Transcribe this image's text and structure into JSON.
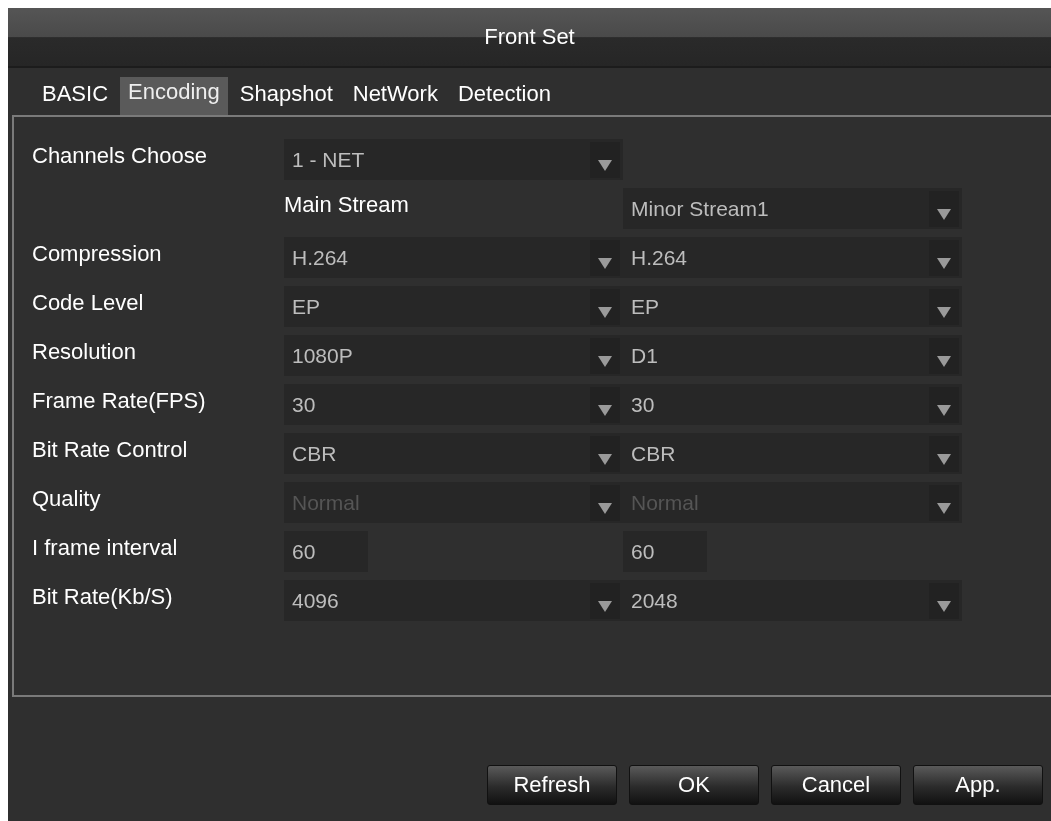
{
  "window": {
    "title": "Front Set"
  },
  "tabs": [
    {
      "label": "BASIC",
      "selected": false
    },
    {
      "label": "Encoding",
      "selected": true
    },
    {
      "label": "Shapshot",
      "selected": false
    },
    {
      "label": "NetWork",
      "selected": false
    },
    {
      "label": "Detection",
      "selected": false
    }
  ],
  "channel": {
    "label": "Channels Choose",
    "value": "1 - NET"
  },
  "streams": {
    "main": {
      "kind": "label",
      "value": "Main Stream"
    },
    "minor": {
      "kind": "select",
      "value": "Minor Stream1"
    }
  },
  "rows": [
    {
      "label": "Compression",
      "main": {
        "kind": "select",
        "value": "H.264",
        "disabled": false
      },
      "minor": {
        "kind": "select",
        "value": "H.264",
        "disabled": false
      }
    },
    {
      "label": "Code Level",
      "main": {
        "kind": "select",
        "value": "EP",
        "disabled": false
      },
      "minor": {
        "kind": "select",
        "value": "EP",
        "disabled": false
      }
    },
    {
      "label": "Resolution",
      "main": {
        "kind": "select",
        "value": "1080P",
        "disabled": false
      },
      "minor": {
        "kind": "select",
        "value": "D1",
        "disabled": false
      }
    },
    {
      "label": "Frame Rate(FPS)",
      "main": {
        "kind": "select",
        "value": "30",
        "disabled": false
      },
      "minor": {
        "kind": "select",
        "value": "30",
        "disabled": false
      }
    },
    {
      "label": "Bit Rate Control",
      "main": {
        "kind": "select",
        "value": "CBR",
        "disabled": false
      },
      "minor": {
        "kind": "select",
        "value": "CBR",
        "disabled": false
      }
    },
    {
      "label": "Quality",
      "main": {
        "kind": "select",
        "value": "Normal",
        "disabled": true
      },
      "minor": {
        "kind": "select",
        "value": "Normal",
        "disabled": true
      }
    },
    {
      "label": "I frame interval",
      "main": {
        "kind": "input",
        "value": "60",
        "disabled": false
      },
      "minor": {
        "kind": "input",
        "value": "60",
        "disabled": false
      }
    },
    {
      "label": "Bit Rate(Kb/S)",
      "main": {
        "kind": "select",
        "value": "4096",
        "disabled": false
      },
      "minor": {
        "kind": "select",
        "value": "2048",
        "disabled": false
      }
    }
  ],
  "buttons": [
    "Refresh",
    "OK",
    "Cancel",
    "App."
  ]
}
